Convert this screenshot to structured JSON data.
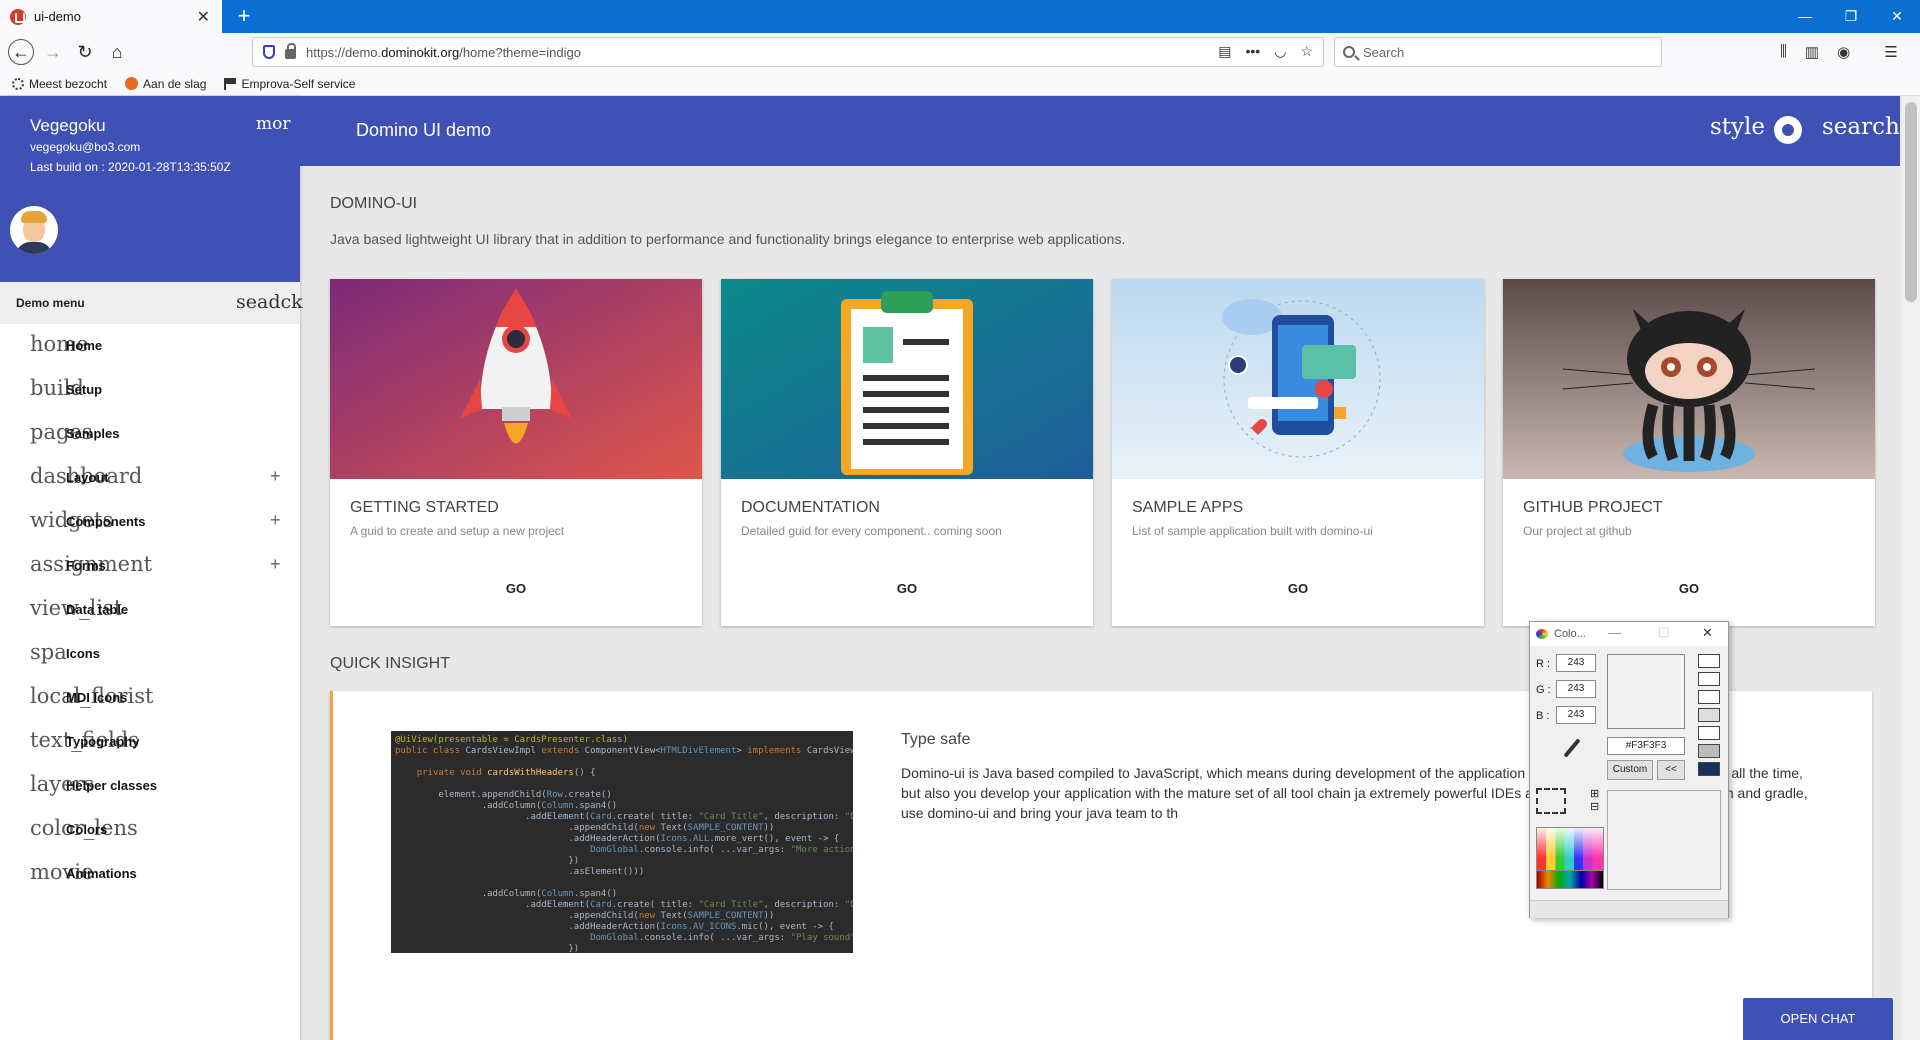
{
  "browser": {
    "tab_title": "ui-demo",
    "tab_close": "✕",
    "new_tab": "+",
    "url_prefix": "https://demo.",
    "url_host": "dominokit.org",
    "url_path": "/home?theme=indigo",
    "search_placeholder": "Search",
    "bookmarks": [
      "Meest bezocht",
      "Aan de slag",
      "Emprova-Self service"
    ]
  },
  "sidebar": {
    "user_name": "Vegegoku",
    "user_email": "vegegoku@bo3.com",
    "last_build": "Last build on : 2020-01-28T13:35:50Z",
    "more_icon": "mor",
    "menu_title": "Demo menu",
    "menu_header_icons": "seadck",
    "items": [
      {
        "icon": "home",
        "label": "Home",
        "expandable": false
      },
      {
        "icon": "build",
        "label": "Setup",
        "expandable": false
      },
      {
        "icon": "pages",
        "label": "Samples",
        "expandable": false
      },
      {
        "icon": "dashboard",
        "label": "Layout",
        "expandable": true
      },
      {
        "icon": "widgets",
        "label": "Components",
        "expandable": true
      },
      {
        "icon": "assignment",
        "label": "Forms",
        "expandable": true
      },
      {
        "icon": "view_list",
        "label": "Data table",
        "expandable": false
      },
      {
        "icon": "spa",
        "label": "Icons",
        "expandable": false
      },
      {
        "icon": "local_florist",
        "label": "MDI Icons",
        "expandable": false
      },
      {
        "icon": "text_fields",
        "label": "Typography",
        "expandable": false
      },
      {
        "icon": "layers",
        "label": "Helper classes",
        "expandable": false
      },
      {
        "icon": "color_lens",
        "label": "Colors",
        "expandable": false
      },
      {
        "icon": "movie",
        "label": "Animations",
        "expandable": false
      }
    ]
  },
  "header": {
    "title": "Domino UI demo",
    "style_icon": "style",
    "search_icon": "search"
  },
  "main": {
    "title": "DOMINO-UI",
    "subtitle": "Java based lightweight UI library that in addition to performance and functionality brings elegance to enterprise web applications.",
    "cards": [
      {
        "title": "GETTING STARTED",
        "desc": "A guid to create and setup a new project",
        "action": "GO"
      },
      {
        "title": "DOCUMENTATION",
        "desc": "Detailed guid for every component.. coming soon",
        "action": "GO"
      },
      {
        "title": "SAMPLE APPS",
        "desc": "List of sample application built with domino-ui",
        "action": "GO"
      },
      {
        "title": "GITHUB PROJECT",
        "desc": "Our project at github",
        "action": "GO"
      }
    ],
    "insight_title": "QUICK INSIGHT",
    "type_safe_title": "Type safe",
    "type_safe_text": "Domino-ui is Java based compiled to JavaScript, which means during development of the application you keep your app maintainable all the time, but also you develop your application with the mature set of all tool chain ja extremely powerful IDEs and mature build tools like maven and gradle, use domino-ui and bring your java team to th"
  },
  "chat": {
    "label": "OPEN CHAT"
  },
  "color_dialog": {
    "title": "Colo...",
    "r_label": "R :",
    "g_label": "G :",
    "b_label": "B :",
    "r": "243",
    "g": "243",
    "b": "243",
    "hex": "#F3F3F3",
    "custom_label": "Custom",
    "back_label": "<<",
    "minimize": "—",
    "maximize": "☐",
    "close": "✕"
  },
  "colors": {
    "indigo": "#3f51b5",
    "accent_border": "#f0a83c"
  }
}
